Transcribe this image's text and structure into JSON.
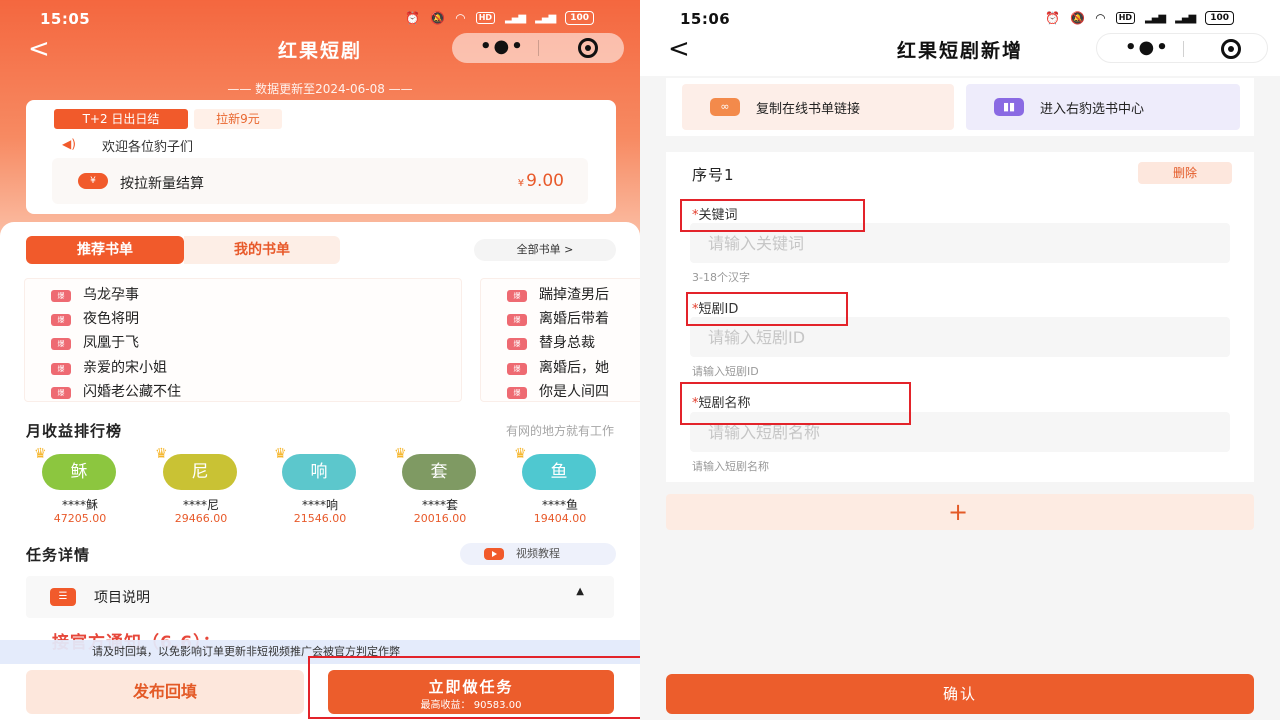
{
  "left": {
    "status": {
      "time": "15:05",
      "battery": "100"
    },
    "nav": {
      "title": "红果短剧",
      "back": "<"
    },
    "update_line": "—— 数据更新至2024-06-08 ——",
    "info": {
      "tag_t2": "T+2 日出日结",
      "tag_new": "拉新9元",
      "welcome": "欢迎各位豹子们",
      "settle_label": "按拉新量结算",
      "settle_currency": "¥",
      "settle_amount": "9.00"
    },
    "tabs": {
      "recommended": "推荐书单",
      "mine": "我的书单",
      "all": "全部书单  >"
    },
    "hot_badge": "爆",
    "books_col1": [
      "乌龙孕事",
      "夜色将明",
      "凤凰于飞",
      "亲爱的宋小姐",
      "闪婚老公藏不住"
    ],
    "books_col2": [
      "踹掉渣男后",
      "离婚后带着",
      "替身总裁",
      "离婚后，她",
      "你是人间四"
    ],
    "ranking": {
      "title": "月收益排行榜",
      "subtitle": "有网的地方就有工作",
      "items": [
        {
          "avatar": "稣",
          "name": "****稣",
          "amount": "47205.00",
          "color": "#8cc63f"
        },
        {
          "avatar": "尼",
          "name": "****尼",
          "amount": "29466.00",
          "color": "#c9c234"
        },
        {
          "avatar": "响",
          "name": "****响",
          "amount": "21546.00",
          "color": "#5cc7cc"
        },
        {
          "avatar": "套",
          "name": "****套",
          "amount": "20016.00",
          "color": "#7f9a63"
        },
        {
          "avatar": "鱼",
          "name": "****鱼",
          "amount": "19404.00",
          "color": "#4fc8d0"
        }
      ]
    },
    "task": {
      "title": "任务详情",
      "video": "视频教程",
      "project": "项目说明"
    },
    "notice_peek": "接官方通知（6.6）：",
    "notice_bar": "请及时回填，以免影响订单更新非短视频推广会被官方判定作弊",
    "buttons": {
      "publish": "发布回填",
      "do_task": "立即做任务",
      "max_income": "最高收益：  90583.00"
    }
  },
  "right": {
    "status": {
      "time": "15:06",
      "battery": "100"
    },
    "nav": {
      "title": "红果短剧新增",
      "back": "<"
    },
    "actions": {
      "copy": "复制在线书单链接",
      "center": "进入右豹选书中心"
    },
    "form": {
      "seq": "序号1",
      "delete": "删除",
      "required_mark": "*",
      "keyword_label": "关键词",
      "keyword_placeholder": "请输入关键词",
      "keyword_hint": "3-18个汉字",
      "id_label": "短剧ID",
      "id_placeholder": "请输入短剧ID",
      "id_hint": "请输入短剧ID",
      "name_label": "短剧名称",
      "name_placeholder": "请输入短剧名称",
      "name_hint": "请输入短剧名称"
    },
    "add": "+",
    "confirm": "确认"
  },
  "colors": {
    "accent": "#ec5d2c",
    "highlight": "#e3232a"
  },
  "icons": [
    "back-arrow-icon",
    "more-dots-icon",
    "target-icon",
    "speaker-icon",
    "yen-icon",
    "hot-badge-icon",
    "crown-icon",
    "play-icon",
    "list-icon",
    "link-icon",
    "book-icon",
    "plus-icon"
  ]
}
